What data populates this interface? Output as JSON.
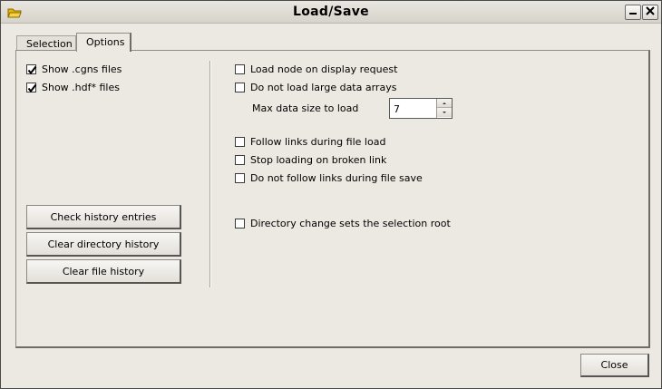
{
  "window": {
    "title": "Load/Save"
  },
  "tabs": [
    {
      "label": "Selection"
    },
    {
      "label": "Options"
    }
  ],
  "left": {
    "checkboxes": [
      {
        "label": "Show .cgns files",
        "checked": true
      },
      {
        "label": "Show .hdf* files",
        "checked": true
      }
    ],
    "buttons": [
      {
        "label": "Check history entries"
      },
      {
        "label": "Clear directory history"
      },
      {
        "label": "Clear file history"
      }
    ]
  },
  "right": {
    "load_node": {
      "label": "Load node on display request",
      "checked": false
    },
    "no_large": {
      "label": "Do not load large data arrays",
      "checked": false
    },
    "max_size": {
      "label": "Max data size to load",
      "value": "7"
    },
    "follow_links": {
      "label": "Follow links during file load",
      "checked": false
    },
    "stop_broken": {
      "label": "Stop loading on broken link",
      "checked": false
    },
    "no_follow_save": {
      "label": "Do not follow links during file save",
      "checked": false
    },
    "dir_root": {
      "label": "Directory change sets the selection root",
      "checked": false
    }
  },
  "footer": {
    "close_label": "Close"
  }
}
